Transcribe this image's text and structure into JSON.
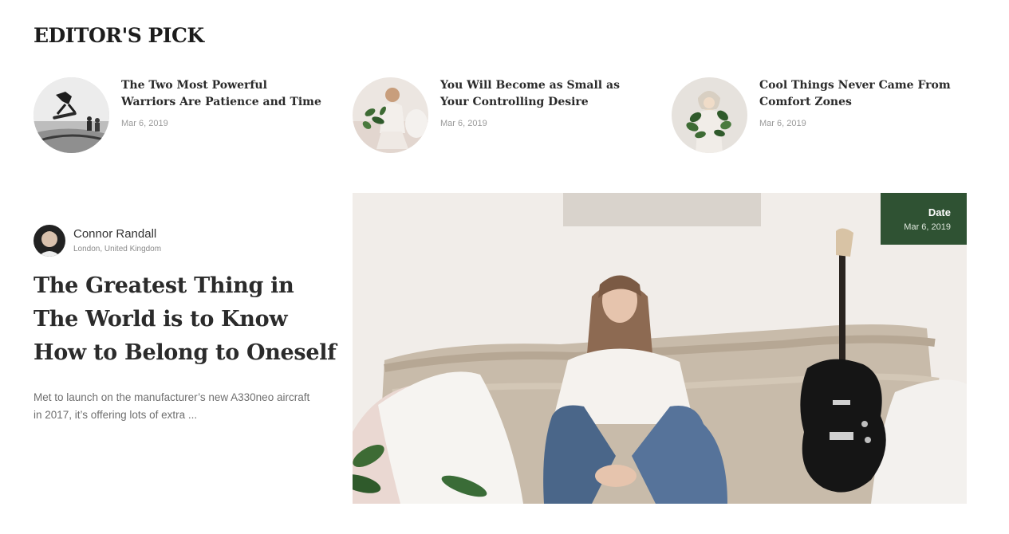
{
  "section": {
    "title": "EDITOR'S PICK"
  },
  "picks": [
    {
      "title": "The Two Most Powerful Warriors Are Patience and Time",
      "date": "Mar 6, 2019",
      "image": "skateboarder-photo"
    },
    {
      "title": "You Will Become as Small as Your Controlling Desire",
      "date": "Mar 6, 2019",
      "image": "woman-with-plant-photo"
    },
    {
      "title": "Cool Things Never Came From Comfort Zones",
      "date": "Mar 6, 2019",
      "image": "girl-with-leaves-photo"
    }
  ],
  "featured": {
    "author": {
      "name": "Connor Randall",
      "location": "London, United Kingdom",
      "avatar": "author-avatar-photo"
    },
    "title": "The Greatest Thing in The World is to Know How to Belong to Oneself",
    "excerpt": "Met to launch on the manufacturer’s new A330neo aircraft in 2017, it’s offering lots of extra ...",
    "image": "woman-on-sofa-with-guitar-photo",
    "date_badge": {
      "label": "Date",
      "value": "Mar 6, 2019"
    }
  },
  "colors": {
    "accent": "#2f5233",
    "title": "#2b2b2b",
    "muted": "#9a9a9a"
  }
}
